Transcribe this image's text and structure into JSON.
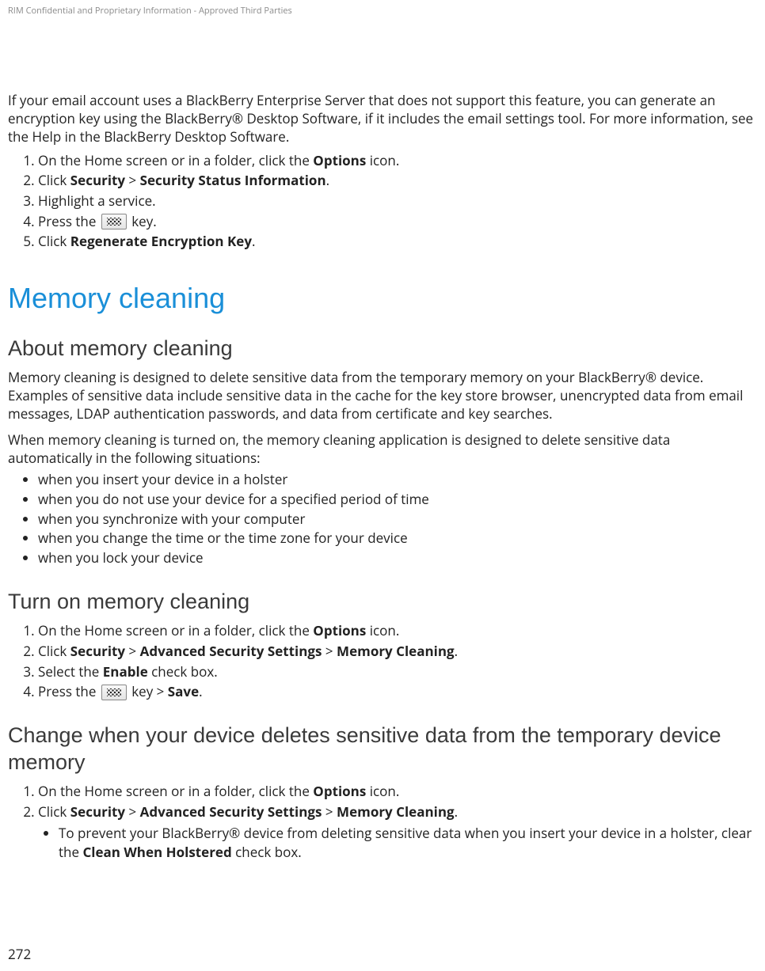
{
  "header": {
    "confidential": "RIM Confidential and Proprietary Information - Approved Third Parties"
  },
  "intro": "If your email account uses a BlackBerry Enterprise Server that does not support this feature, you can generate an encryption key using the BlackBerry® Desktop Software, if it includes the email settings tool. For more information, see the Help in the BlackBerry Desktop Software.",
  "steps_regenerate": {
    "s1_pre": "On the Home screen or in a folder, click the ",
    "s1_bold": "Options",
    "s1_post": " icon.",
    "s2_pre": "Click ",
    "s2_b1": "Security",
    "s2_mid": " > ",
    "s2_b2": "Security Status Information",
    "s2_post": ".",
    "s3": "Highlight a service.",
    "s4_pre": "Press the ",
    "s4_post": " key.",
    "s5_pre": "Click ",
    "s5_bold": "Regenerate Encryption Key",
    "s5_post": "."
  },
  "section_title": "Memory cleaning",
  "about": {
    "heading": "About memory cleaning",
    "p1": "Memory cleaning is designed to delete sensitive data from the temporary memory on your BlackBerry® device. Examples of sensitive data include sensitive data in the cache for the key store browser, unencrypted data from email messages, LDAP authentication passwords, and data from certificate and key searches.",
    "p2": "When memory cleaning is turned on, the memory cleaning application is designed to delete sensitive data automatically in the following situations:",
    "bullets": [
      "when you insert your device in a holster",
      "when you do not use your device for a specified period of time",
      "when you synchronize with your computer",
      "when you change the time or the time zone for your device",
      "when you lock your device"
    ]
  },
  "turn_on": {
    "heading": "Turn on memory cleaning",
    "s1_pre": "On the Home screen or in a folder, click the ",
    "s1_bold": "Options",
    "s1_post": " icon.",
    "s2_pre": "Click ",
    "s2_b1": "Security",
    "s2_mid1": " > ",
    "s2_b2": "Advanced Security Settings",
    "s2_mid2": " > ",
    "s2_b3": "Memory Cleaning",
    "s2_post": ".",
    "s3_pre": "Select the ",
    "s3_bold": "Enable",
    "s3_post": " check box.",
    "s4_pre": "Press the ",
    "s4_mid": " key > ",
    "s4_bold": "Save",
    "s4_post": "."
  },
  "change": {
    "heading": "Change when your device deletes sensitive data from the temporary device memory",
    "s1_pre": "On the Home screen or in a folder, click the ",
    "s1_bold": "Options",
    "s1_post": " icon.",
    "s2_pre": "Click ",
    "s2_b1": "Security",
    "s2_mid1": " > ",
    "s2_b2": "Advanced Security Settings",
    "s2_mid2": " > ",
    "s2_b3": "Memory Cleaning",
    "s2_post": ".",
    "sub_pre": "To prevent your BlackBerry® device from deleting sensitive data when you insert your device in a holster, clear the ",
    "sub_bold": "Clean When Holstered",
    "sub_post": " check box."
  },
  "page_number": "272"
}
